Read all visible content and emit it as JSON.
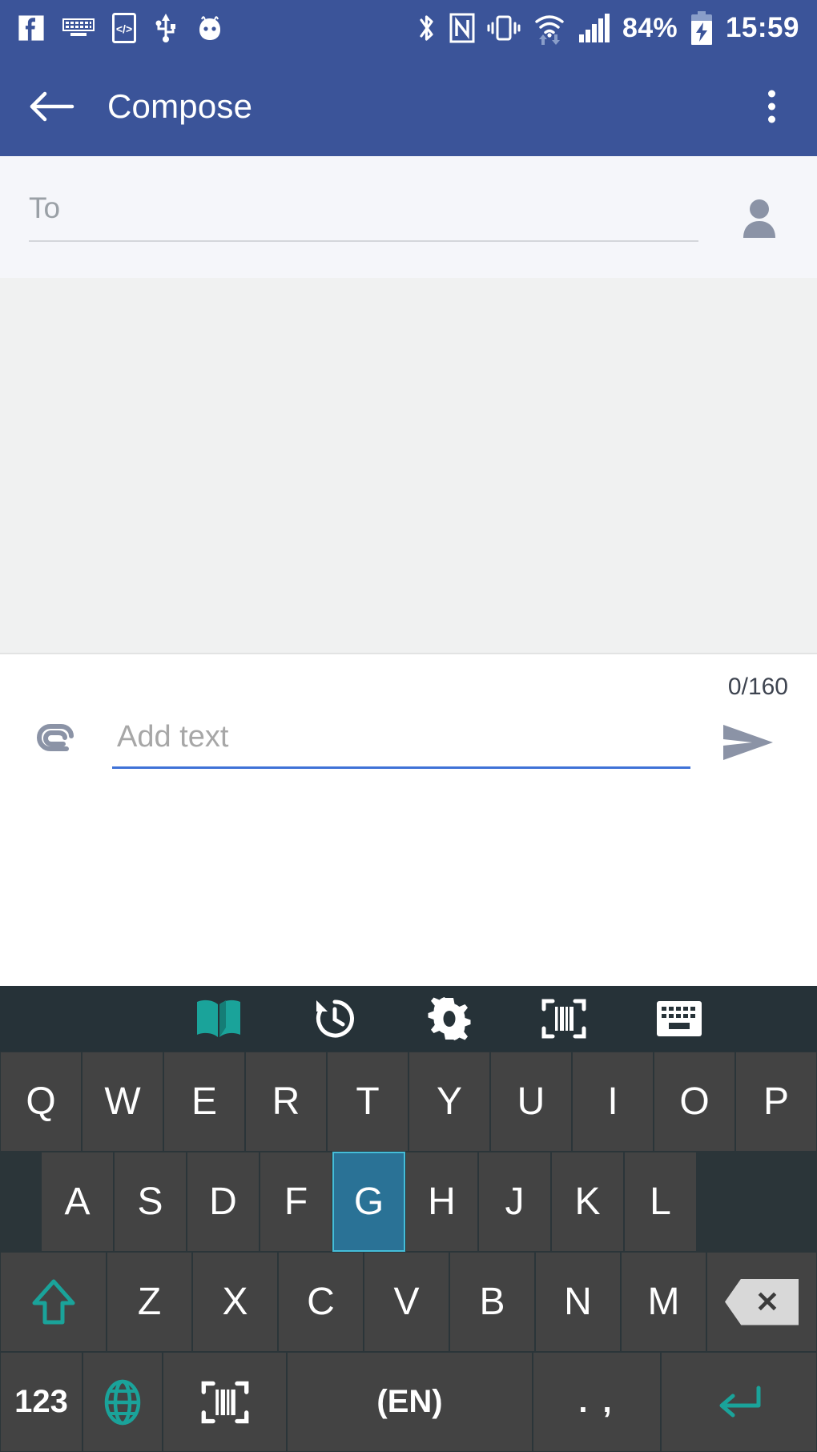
{
  "statusbar": {
    "left_icons": [
      {
        "name": "facebook-icon"
      },
      {
        "name": "keyboard-active-icon"
      },
      {
        "name": "developer-options-icon"
      },
      {
        "name": "usb-icon"
      },
      {
        "name": "cyanogenmod-icon"
      }
    ],
    "right_icons": [
      {
        "name": "bluetooth-icon"
      },
      {
        "name": "nfc-icon"
      },
      {
        "name": "vibrate-mode-icon"
      },
      {
        "name": "wifi-icon"
      },
      {
        "name": "cellular-signal-icon"
      }
    ],
    "battery_percent": "84%",
    "battery_state": "charging",
    "time": "15:59",
    "background_color": "#3b5499"
  },
  "appbar": {
    "back_label": "back-arrow",
    "title": "Compose",
    "overflow_label": "more-options",
    "background_color": "#3b5499"
  },
  "recipient": {
    "placeholder": "To",
    "value": "",
    "contact_picker_label": "contacts"
  },
  "message": {
    "body_value": "",
    "char_counter": "0/160",
    "attach_label": "attach",
    "input_placeholder": "Add text",
    "input_value": "",
    "send_label": "send",
    "underline_color": "#3f72d7"
  },
  "keyboard": {
    "toolbar": [
      {
        "name": "dictionary-icon",
        "color": "#1aa39a"
      },
      {
        "name": "history-icon",
        "color": "#ffffff"
      },
      {
        "name": "settings-gear-icon",
        "color": "#ffffff"
      },
      {
        "name": "barcode-scanner-icon",
        "color": "#ffffff"
      },
      {
        "name": "keyboard-layout-icon",
        "color": "#ffffff"
      }
    ],
    "pressed_key": "G",
    "accent_color": "#1aa39a",
    "pressed_color": "#2a7296",
    "row1": [
      "Q",
      "W",
      "E",
      "R",
      "T",
      "Y",
      "U",
      "I",
      "O",
      "P"
    ],
    "row2": [
      "A",
      "S",
      "D",
      "F",
      "G",
      "H",
      "J",
      "K",
      "L"
    ],
    "row3": [
      "Z",
      "X",
      "C",
      "V",
      "B",
      "N",
      "M"
    ],
    "shift_label": "shift",
    "backspace_label": "backspace",
    "row4": {
      "numbers": "123",
      "globe": "language",
      "scanner": "barcode-scan",
      "space": "(EN)",
      "punctuation": ". ,",
      "enter": "enter"
    }
  }
}
